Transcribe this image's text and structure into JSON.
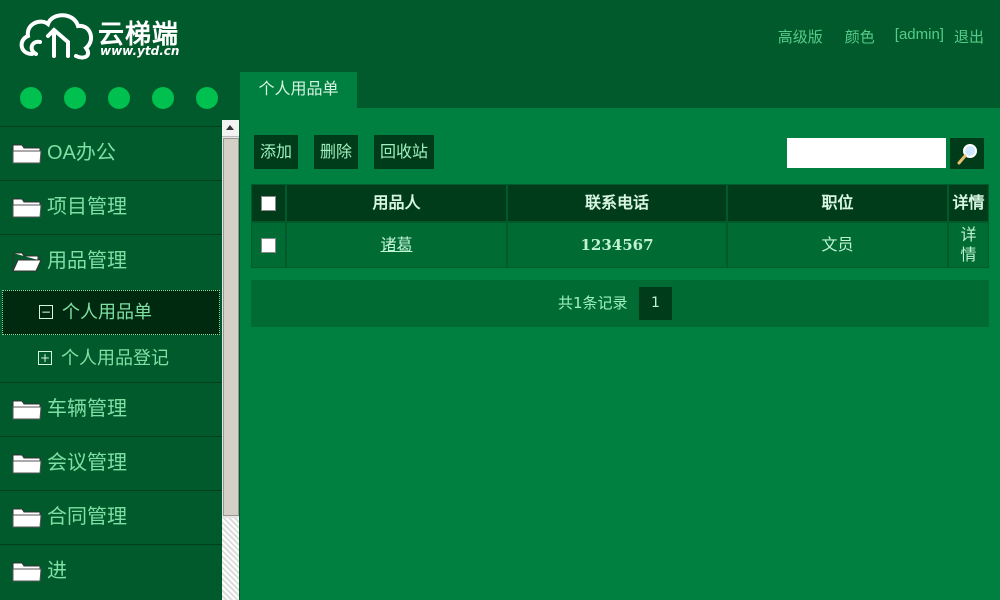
{
  "header": {
    "brand": "云梯端",
    "url": "www.ytd.cn",
    "nav": {
      "advanced": "高级版",
      "color": "颜色",
      "user": "[admin]",
      "logout": "退出"
    }
  },
  "sidebar": {
    "menu": [
      {
        "label": "OA办公"
      },
      {
        "label": "项目管理"
      },
      {
        "label": "用品管理",
        "expanded": true
      }
    ],
    "submenu": [
      {
        "label": "个人用品单",
        "active": true
      },
      {
        "label": "个人用品登记"
      }
    ],
    "menu_after": [
      {
        "label": "车辆管理"
      },
      {
        "label": "会议管理"
      },
      {
        "label": "合同管理"
      },
      {
        "label": "进"
      }
    ]
  },
  "tab": {
    "label": "个人用品单"
  },
  "toolbar": {
    "add": "添加",
    "delete": "删除",
    "recycle": "回收站",
    "search_value": ""
  },
  "table": {
    "headers": [
      "用品人",
      "联系电话",
      "职位",
      "详情"
    ],
    "rows": [
      {
        "user": "诸葛",
        "phone": "1234567",
        "position": "文员",
        "detail": "详情"
      }
    ]
  },
  "pager": {
    "info": "共1条记录",
    "page": "1"
  },
  "colors": {
    "background": "#008040",
    "header": "#005a2c",
    "accent": "#00c050",
    "dark": "#003c1a"
  }
}
